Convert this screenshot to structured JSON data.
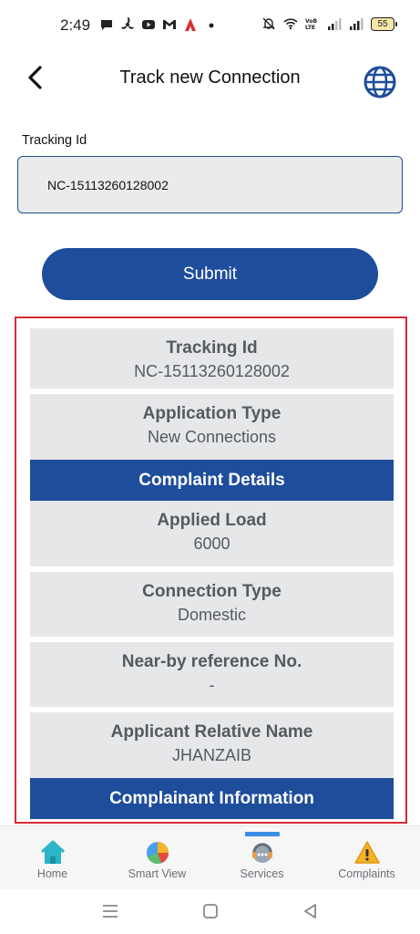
{
  "status_bar": {
    "time": "2:49",
    "battery": "55",
    "left_icons": [
      "chat-icon",
      "fan-icon",
      "youtube-icon",
      "gmail-icon",
      "app-icon",
      "dot-icon"
    ],
    "right_icons": [
      "mute-icon",
      "wifi-icon",
      "volte-icon",
      "signal-icon",
      "signal-icon"
    ]
  },
  "header": {
    "title": "Track new Connection",
    "back_icon": "chevron-left-icon",
    "globe_icon": "globe-icon"
  },
  "form": {
    "label": "Tracking Id",
    "value": "NC-15113260128002",
    "submit_label": "Submit"
  },
  "result": {
    "rows_top": [
      {
        "key": "Tracking Id",
        "value": "NC-15113260128002"
      },
      {
        "key": "Application Type",
        "value": "New Connections"
      }
    ],
    "section_1": "Complaint Details",
    "rows_mid": [
      {
        "key": "Applied Load",
        "value": "6000"
      },
      {
        "key": "Connection Type",
        "value": "Domestic"
      },
      {
        "key": "Near-by reference No.",
        "value": "-"
      },
      {
        "key": "Applicant Relative Name",
        "value": "JHANZAIB"
      }
    ],
    "section_2": "Complainant Information"
  },
  "bottom_nav": {
    "items": [
      {
        "label": "Home",
        "icon": "home-icon"
      },
      {
        "label": "Smart View",
        "icon": "pie-chart-icon"
      },
      {
        "label": "Services",
        "icon": "support-icon"
      },
      {
        "label": "Complaints",
        "icon": "warning-icon"
      }
    ],
    "active_index": 2
  },
  "colors": {
    "primary": "#1e4d9b",
    "panel_border": "#d62a36",
    "row_bg": "#e6e7e9",
    "active_tab": "#3a8ee6"
  }
}
